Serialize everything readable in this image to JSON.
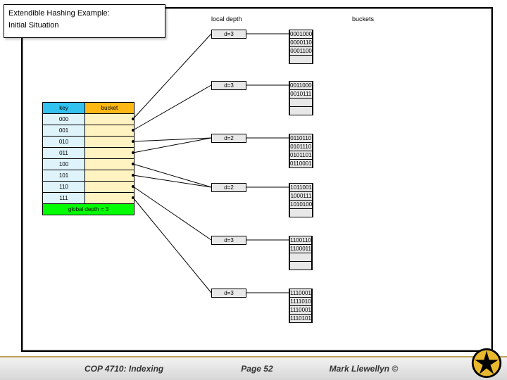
{
  "title_line1": "Extendible Hashing Example:",
  "title_line2": "Initial Situation",
  "labels": {
    "local_depth": "local depth",
    "buckets": "buckets",
    "key_header": "key",
    "bucket_header": "bucket",
    "global_depth": "global depth = 3"
  },
  "directory": [
    "000",
    "001",
    "010",
    "011",
    "100",
    "101",
    "110",
    "111"
  ],
  "buckets": [
    {
      "depth": "d=3",
      "rows": [
        "0001000",
        "0000110",
        "0001100",
        ""
      ]
    },
    {
      "depth": "d=3",
      "rows": [
        "0011000",
        "0010111",
        "",
        ""
      ]
    },
    {
      "depth": "d=2",
      "rows": [
        "0110110",
        "0101110",
        "0101101",
        "0110001"
      ]
    },
    {
      "depth": "d=2",
      "rows": [
        "1011001",
        "1000111",
        "1010100",
        ""
      ]
    },
    {
      "depth": "d=3",
      "rows": [
        "1100110",
        "1100011",
        "",
        ""
      ]
    },
    {
      "depth": "d=3",
      "rows": [
        "1110001",
        "1111010",
        "1110001",
        "1110101"
      ]
    }
  ],
  "footer": {
    "course": "COP 4710: Indexing",
    "page": "Page 52",
    "author": "Mark Llewellyn ©"
  }
}
